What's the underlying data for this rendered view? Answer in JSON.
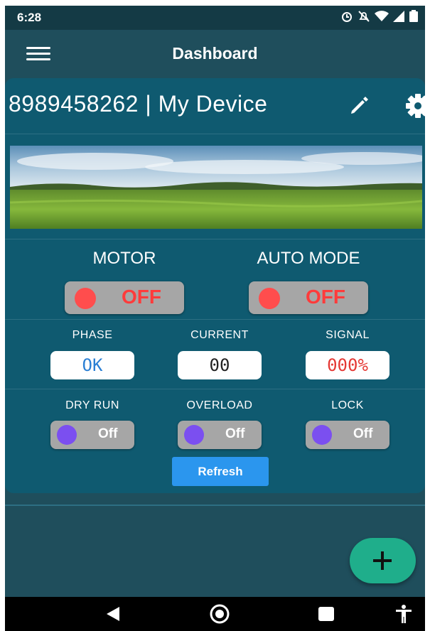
{
  "status_bar": {
    "time": "6:28",
    "icons": [
      "alarm-icon",
      "mute-icon",
      "wifi-icon",
      "signal-icon",
      "battery-icon"
    ]
  },
  "app_bar": {
    "title": "Dashboard",
    "menu_icon": "hamburger-menu-icon"
  },
  "device": {
    "title": "8989458262 | My Device",
    "edit_icon": "pencil-icon",
    "settings_icon": "gear-icon"
  },
  "banner": {
    "description_icon": "field-landscape-image"
  },
  "controls": {
    "motor": {
      "label": "MOTOR",
      "state": "OFF"
    },
    "auto_mode": {
      "label": "AUTO MODE",
      "state": "OFF"
    }
  },
  "readings": {
    "phase": {
      "label": "PHASE",
      "value": "OK"
    },
    "current": {
      "label": "CURRENT",
      "value": "00"
    },
    "signal": {
      "label": "SIGNAL",
      "value": "000%"
    }
  },
  "protections": {
    "dry_run": {
      "label": "DRY RUN",
      "state": "Off"
    },
    "overload": {
      "label": "OVERLOAD",
      "state": "Off"
    },
    "lock": {
      "label": "LOCK",
      "state": "Off"
    }
  },
  "refresh_label": "Refresh",
  "fab_icon": "plus-icon",
  "nav_bar": [
    "back-icon",
    "home-icon",
    "recents-icon",
    "accessibility-icon"
  ],
  "colors": {
    "background": "#1f4e5c",
    "status_bar": "#143a45",
    "card": "#0f5a70",
    "toggle_off_red": "#ff4d4d",
    "toggle_knob_purple": "#7b4ff0",
    "refresh_blue": "#2b96ee",
    "fab_green": "#1fae8b",
    "phase_text_blue": "#2a7fd4",
    "signal_text_red": "#e53935"
  }
}
